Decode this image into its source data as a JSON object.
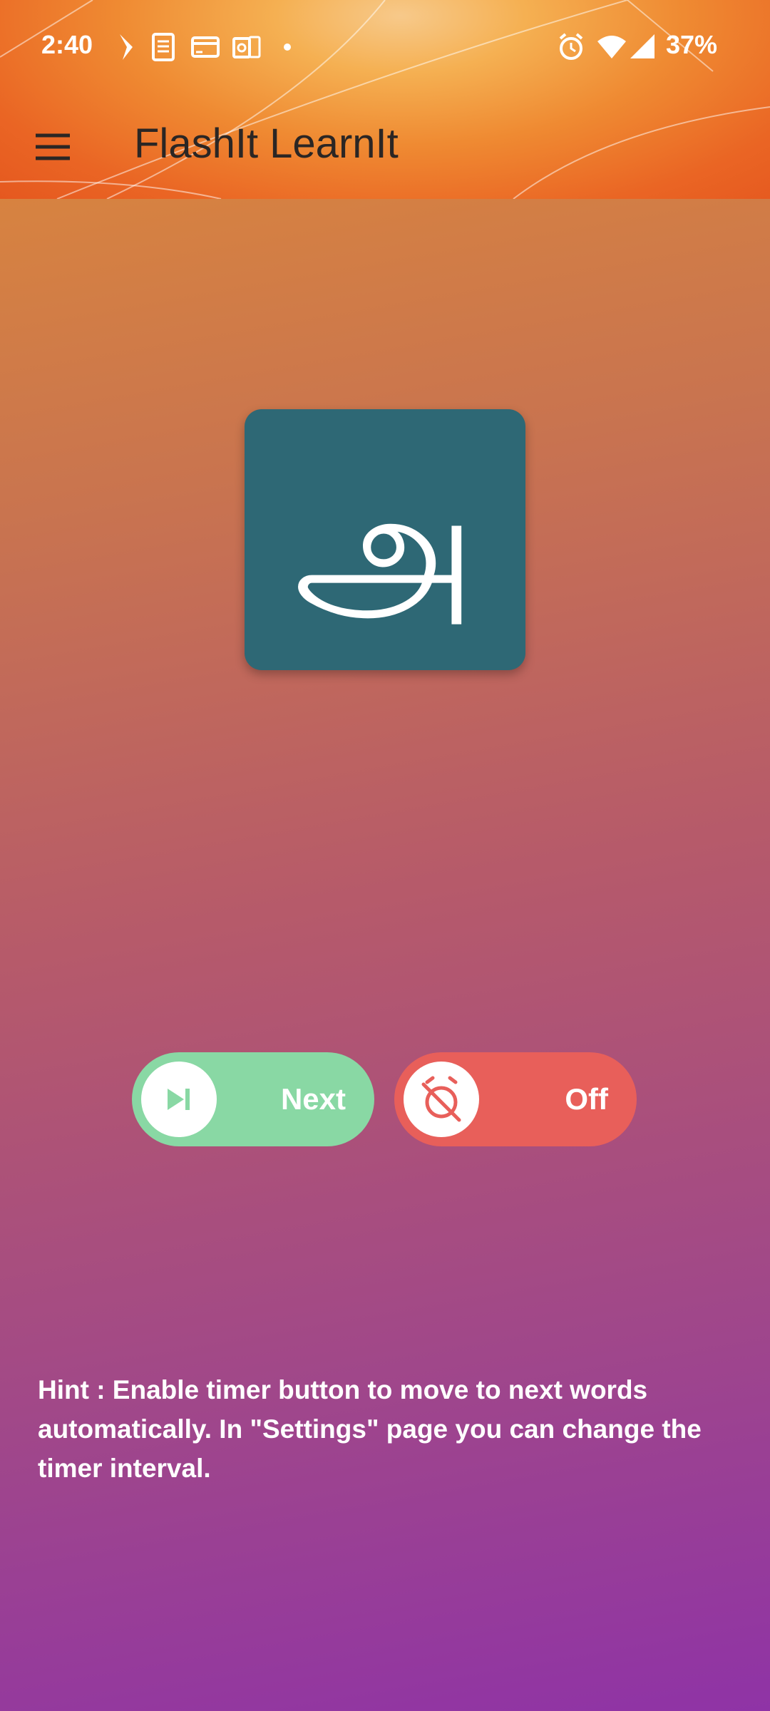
{
  "status_bar": {
    "time": "2:40",
    "battery": "37%",
    "left_icons": [
      "navigation-icon",
      "document-icon",
      "card-icon",
      "outlook-icon",
      "dot-icon"
    ],
    "right_icons": [
      "alarm-icon",
      "wifi-icon",
      "signal-icon"
    ]
  },
  "app_bar": {
    "title": "FlashIt LearnIt",
    "menu_icon": "hamburger-menu-icon"
  },
  "flashcard": {
    "character": "அ",
    "background_color": "#2e6875"
  },
  "controls": {
    "next": {
      "label": "Next",
      "icon": "skip-next-icon",
      "color": "#89d8a4"
    },
    "timer": {
      "label": "Off",
      "icon": "timer-off-icon",
      "color": "#e85f5a"
    }
  },
  "hint": {
    "text": "Hint : Enable timer button to move to next words automatically. In \"Settings\" page you can change the timer interval."
  }
}
